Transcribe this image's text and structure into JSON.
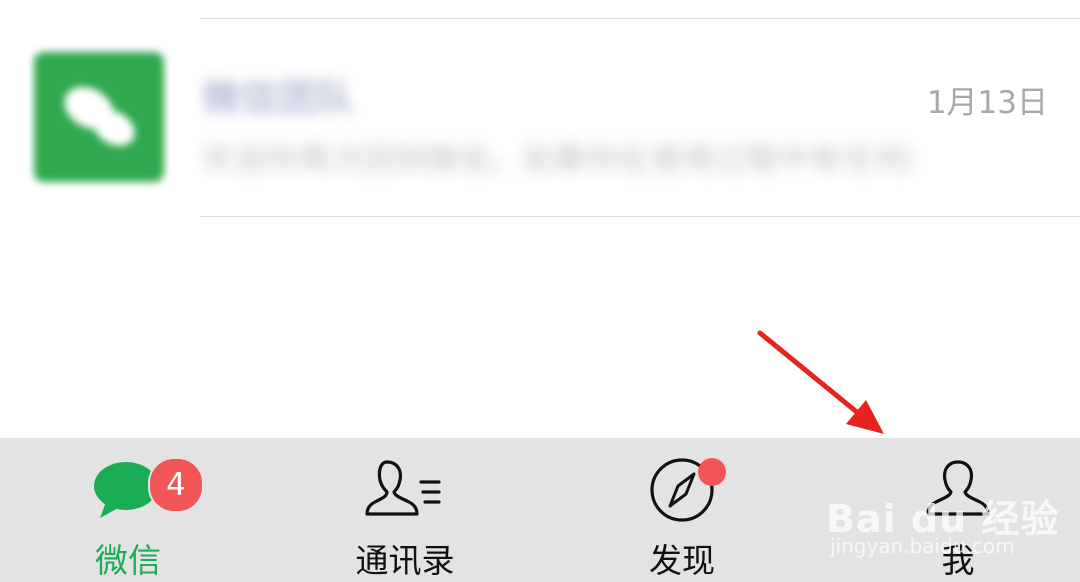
{
  "chat_list": {
    "items": [
      {
        "name": "微信团队",
        "preview": "欢迎你再次回到微信。如果你在使用过程中有任何的问题或建议，记得给我发信息反馈哦。",
        "time": "1月13日"
      }
    ]
  },
  "tabbar": {
    "tabs": [
      {
        "label": "微信",
        "icon": "chat-bubbles-icon",
        "active": true,
        "badge": "4"
      },
      {
        "label": "通讯录",
        "icon": "contacts-icon",
        "active": false
      },
      {
        "label": "发现",
        "icon": "compass-icon",
        "active": false,
        "dot": true
      },
      {
        "label": "我",
        "icon": "person-icon",
        "active": false
      }
    ]
  },
  "watermark": {
    "logo": "Bai du 经验",
    "url": "jingyan.baidu.com"
  },
  "colors": {
    "accent_green": "#1aad55",
    "badge_red": "#f25656",
    "arrow_red": "#e8231d",
    "tabbar_bg": "#e3e3e3"
  }
}
